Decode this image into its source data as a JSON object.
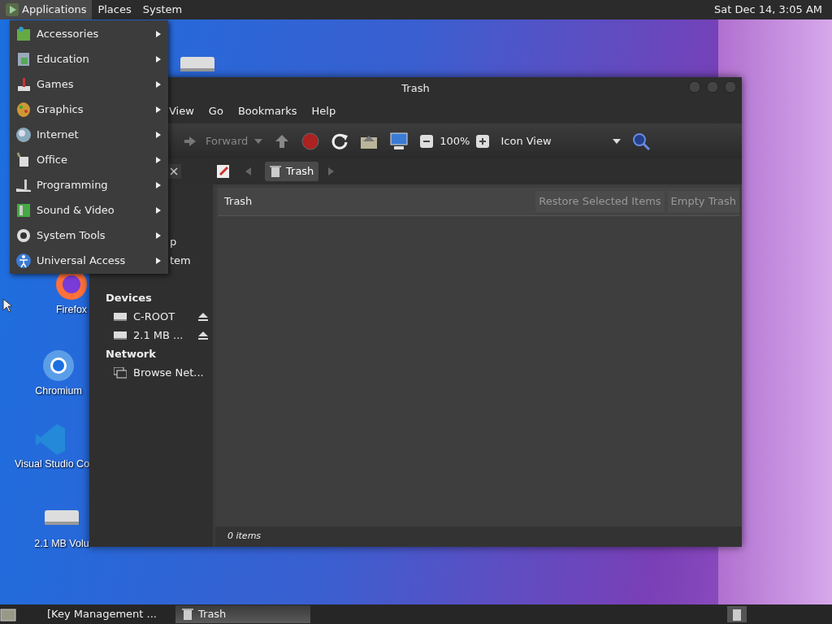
{
  "top_panel": {
    "menus": [
      {
        "label": "Applications",
        "selected": true
      },
      {
        "label": "Places",
        "selected": false
      },
      {
        "label": "System",
        "selected": false
      }
    ],
    "clock": "Sat Dec 14,  3:05 AM"
  },
  "app_menu": {
    "items": [
      {
        "label": "Accessories"
      },
      {
        "label": "Education"
      },
      {
        "label": "Games"
      },
      {
        "label": "Graphics"
      },
      {
        "label": "Internet"
      },
      {
        "label": "Office"
      },
      {
        "label": "Programming"
      },
      {
        "label": "Sound & Video"
      },
      {
        "label": "System Tools"
      },
      {
        "label": "Universal Access"
      }
    ]
  },
  "desktop_icons": [
    {
      "kind": "drive"
    },
    {
      "kind": "firefox",
      "label": "Firefox"
    },
    {
      "kind": "chromium",
      "label": "Chromium"
    },
    {
      "kind": "vscode",
      "label": "Visual Studio Co"
    },
    {
      "kind": "drive",
      "label": "2.1 MB Volu"
    }
  ],
  "window": {
    "title": "Trash",
    "menubar": [
      "View",
      "Go",
      "Bookmarks",
      "Help"
    ],
    "toolbar": {
      "forward": {
        "label": "Forward",
        "disabled": true
      },
      "zoom_level": "100%",
      "view_mode": "Icon View"
    },
    "location": {
      "crumb": "Trash"
    },
    "sidebar": [
      {
        "kind": "partial",
        "label": "p"
      },
      {
        "kind": "partial",
        "label": "tem"
      },
      {
        "kind": "heading",
        "label": "Devices"
      },
      {
        "kind": "drive",
        "label": "C-ROOT",
        "eject": true
      },
      {
        "kind": "drive",
        "label": "2.1 MB ...",
        "eject": true
      },
      {
        "kind": "heading",
        "label": "Network"
      },
      {
        "kind": "network",
        "label": "Browse Net...",
        "eject": false
      }
    ],
    "info_bar": {
      "title": "Trash",
      "buttons": [
        {
          "label": "Restore Selected Items",
          "disabled": true
        },
        {
          "label": "Empty Trash",
          "disabled": true
        }
      ]
    },
    "status": "0 items"
  },
  "taskbar": {
    "tasks": [
      {
        "label": "[Key Management ...",
        "selected": false
      },
      {
        "label": "Trash",
        "selected": true
      }
    ]
  }
}
